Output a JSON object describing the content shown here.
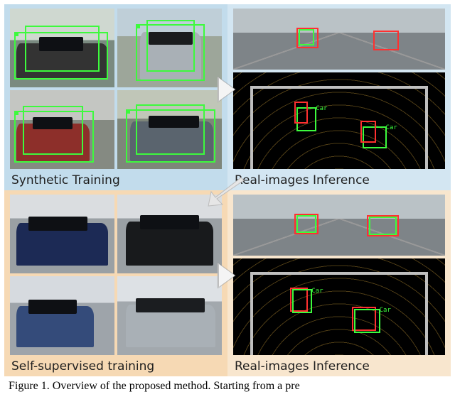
{
  "figure": {
    "top_left_label": "Synthetic Training",
    "top_right_label": "Real-images Inference",
    "bottom_left_label": "Self-supervised training",
    "bottom_right_label": "Real-images Inference",
    "caption_prefix": "Figure 1.",
    "caption_text": "Overview of the proposed method. Starting from a pre"
  },
  "detections": {
    "label_car": "Car"
  }
}
